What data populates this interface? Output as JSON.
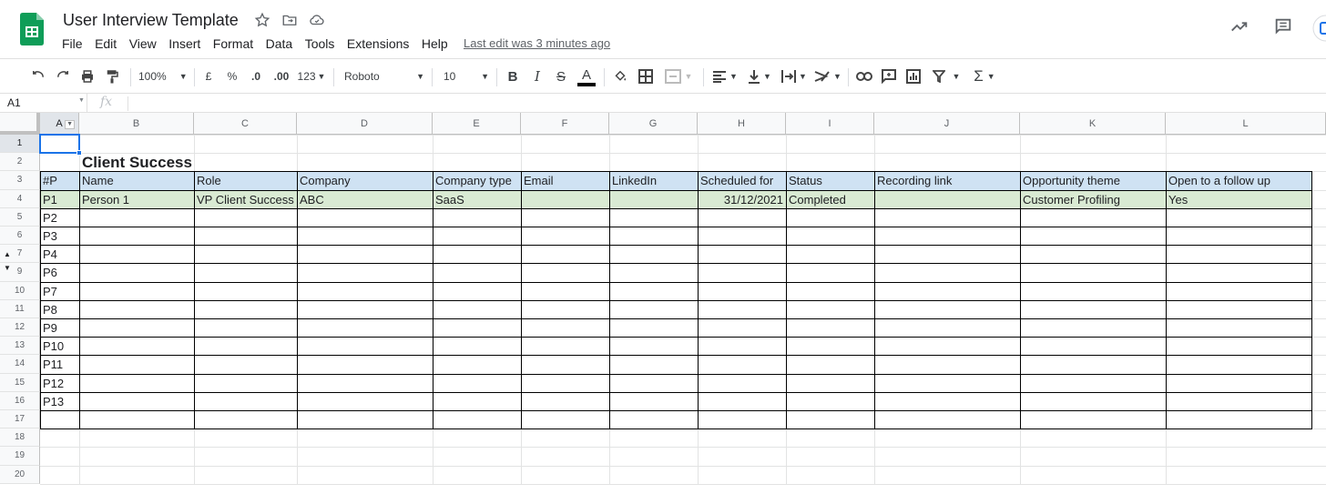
{
  "app": {
    "doc_title": "User Interview Template",
    "last_edit": "Last edit was 3 minutes ago",
    "brand_color": "#0f9d58"
  },
  "menu": [
    "File",
    "Edit",
    "View",
    "Insert",
    "Format",
    "Data",
    "Tools",
    "Extensions",
    "Help"
  ],
  "toolbar": {
    "zoom": "100%",
    "currency": "£",
    "percent": "%",
    "dec_decrease": ".0",
    "dec_increase": ".00",
    "more_formats": "123",
    "font": "Roboto",
    "font_size": "10",
    "bold": "B",
    "italic": "I",
    "strike": "S",
    "text_color": "A"
  },
  "formula_bar": {
    "name_box": "A1",
    "fx": "fx"
  },
  "columns": [
    "A",
    "B",
    "C",
    "D",
    "E",
    "F",
    "G",
    "H",
    "I",
    "J",
    "K",
    "L"
  ],
  "rows": [
    "1",
    "2",
    "3",
    "4",
    "5",
    "6",
    "7",
    "9",
    "10",
    "11",
    "12",
    "13",
    "14",
    "15",
    "16",
    "17",
    "18",
    "19",
    "20"
  ],
  "sheet": {
    "section_title": "Client Success",
    "headers": [
      "#P",
      "Name",
      "Role",
      "Company",
      "Company type",
      "Email",
      "LinkedIn",
      "Scheduled for",
      "Status",
      "Recording link",
      "Opportunity theme",
      "Open to a follow up"
    ],
    "first_row": [
      "P1",
      "Person 1",
      "VP Client Success",
      "ABC",
      "SaaS",
      "",
      "",
      "31/12/2021",
      "Completed",
      "",
      "Customer Profiling",
      "Yes"
    ],
    "ids": [
      "P2",
      "P3",
      "P4",
      "P6",
      "P7",
      "P8",
      "P9",
      "P10",
      "P11",
      "P12",
      "P13"
    ],
    "header_fill": "#cfe2f3",
    "row_fill": "#d9ead3"
  }
}
